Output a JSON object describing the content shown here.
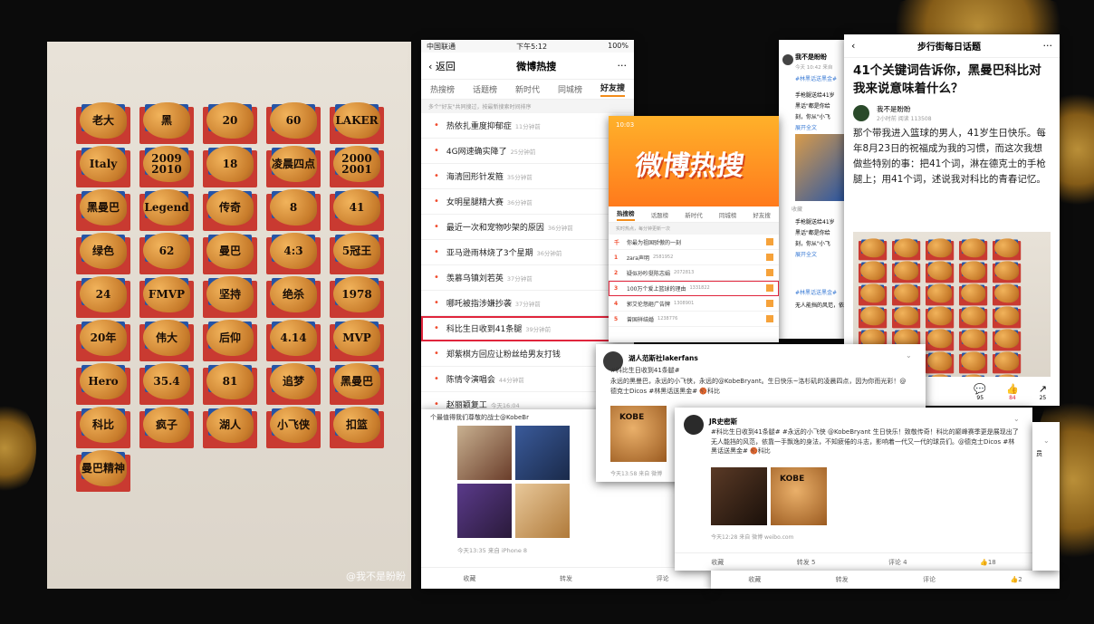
{
  "photo": {
    "watermark": "@我不是盼盼",
    "labels": [
      [
        "老大",
        "黑",
        "20",
        "60",
        "LAKER"
      ],
      [
        "Italy",
        "2009 2010",
        "18",
        "凌晨四点",
        "2000 2001"
      ],
      [
        "黑曼巴",
        "Legend",
        "传奇",
        "8",
        "41"
      ],
      [
        "绿色",
        "62",
        "曼巴",
        "4:3",
        "5冠王"
      ],
      [
        "24",
        "FMVP",
        "坚持",
        "绝杀",
        "1978"
      ],
      [
        "20年",
        "伟大",
        "后仰",
        "4.14",
        "MVP"
      ],
      [
        "Hero",
        "35.4",
        "81",
        "追梦",
        "黑曼巴"
      ],
      [
        "科比",
        "疯子",
        "湖人",
        "小飞侠",
        "扣篮"
      ],
      [
        "曼巴精神"
      ]
    ]
  },
  "hot_search": {
    "status": {
      "carrier": "中国联通",
      "time": "下午5:12",
      "battery": "100%"
    },
    "back": "返回",
    "title": "微博热搜",
    "more": "···",
    "tabs": [
      "热搜榜",
      "话题榜",
      "新时代",
      "同城榜",
      "好友搜"
    ],
    "hint": "多个\"好友\"共同搜过，按最新搜索时间排序",
    "items": [
      {
        "text": "热依扎重度抑郁症",
        "time": "11分钟前"
      },
      {
        "text": "4G网速确实降了",
        "time": "25分钟前"
      },
      {
        "text": "海清回形针发箍",
        "time": "35分钟前"
      },
      {
        "text": "女明星腿精大赛",
        "time": "36分钟前"
      },
      {
        "text": "最近一次和宠物吵架的原因",
        "time": "36分钟前"
      },
      {
        "text": "亚马逊雨林烧了3个星期",
        "time": "36分钟前"
      },
      {
        "text": "羡慕乌镇刘若英",
        "time": "37分钟前"
      },
      {
        "text": "哪吒被指涉嫌抄袭",
        "time": "37分钟前"
      },
      {
        "text": "科比生日收到41条腿",
        "time": "39分钟前"
      },
      {
        "text": "郑紫棋方回应让粉丝给男友打钱",
        "time": ""
      },
      {
        "text": "陈情令演唱会",
        "time": "44分钟前"
      },
      {
        "text": "赵丽颖复工",
        "time": "今天16:04"
      }
    ]
  },
  "banner_screen": {
    "time": "10:03",
    "logo": "微博热搜",
    "tabs": [
      "热搜榜",
      "话题榜",
      "新时代",
      "同城榜",
      "好友搜"
    ],
    "hint": "实时热点，每分钟更新一次",
    "rows": [
      {
        "rank": "千",
        "text": "你最为祖国骄傲的一刻",
        "num": ""
      },
      {
        "rank": "1",
        "text": "zara声明",
        "num": "2581952"
      },
      {
        "rank": "2",
        "text": "疑似孙吵挺陈志娟",
        "num": "2072813"
      },
      {
        "rank": "3",
        "text": "100万个爱上篮球的理由",
        "num": "1331822"
      },
      {
        "rank": "4",
        "text": "郭艾伦怒砸广告牌",
        "num": "1308901"
      },
      {
        "rank": "5",
        "text": "曾国祥结婚",
        "num": "1238776"
      }
    ]
  },
  "post_back": {
    "tags": "士Dicos #林黑话送黑金# 🏀科比",
    "caption": "个最值得我们尊敬的战士@KobeBr",
    "time": "今天13:35",
    "source": "来自 iPhone 8",
    "actions": [
      "收藏",
      "转发",
      "评论"
    ]
  },
  "post_mid": {
    "author": "我不是盼盼",
    "meta": "今天 10:42 来自",
    "tags": "#林黑话送黑金#",
    "text1": "手枪腿送给41岁",
    "text2": "黑话\"都是你给",
    "text3": "刻，你从\"小飞",
    "more": "展开全文",
    "save": "收藏"
  },
  "article": {
    "back": "‹",
    "title_bar": "步行街每日话题",
    "more": "···",
    "headline": "41个关键词告诉你，黑曼巴科比对我来说意味着什么？",
    "author": "我不是盼盼",
    "meta": "2小时前  阅读 113508",
    "body": "那个带我进入篮球的男人，41岁生日快乐。每年8月23日的祝福成为我的习惯，而这次我想做些特别的事：把41个词，淋在德克士的手枪腿上；用41个词，述说我对科比的青春记忆。",
    "counts": [
      "95",
      "84",
      "25"
    ]
  },
  "tweet_lakerfans": {
    "author": "湖人范斯社lakerfans",
    "tag": "#科比生日收到41条腿#",
    "text": "永远的黑曼巴，永远的小飞侠，永远的@KobeBryant。生日快乐~洛杉矶的凌晨四点，因为你而光彩！@德克士Dicos #林黑话送黑金# 🏀科比",
    "img_label": "KOBE",
    "time": "今天13:58",
    "source": "来自 微博"
  },
  "tweet_jr": {
    "author": "JR史密斯",
    "text": "#科比生日收到41条腿# #永远的小飞侠 @KobeBryant 生日快乐！致敬传奇！科比的巅峰赛季更是展现出了无人能挡的风范，依靠一手飘逸的身法，不知疲倦的斗志，影响着一代又一代的球员们。@德克士Dicos #林黑话送黑金# 🏀科比",
    "img_label": "KOBE",
    "time": "今天12:28",
    "source": "来自 微博 weibo.com",
    "actions": [
      "收藏",
      "转发 5",
      "评论 4",
      "👍18"
    ]
  },
  "bottom_bar": {
    "actions": [
      "收藏",
      "转发",
      "评论",
      "👍2"
    ]
  },
  "misc": {
    "partial_caption": "无人能挡的风范，依",
    "partial_tags": "#林黑话送黑金#",
    "partial_author_line": "永远的小",
    "cut_word": "员"
  }
}
